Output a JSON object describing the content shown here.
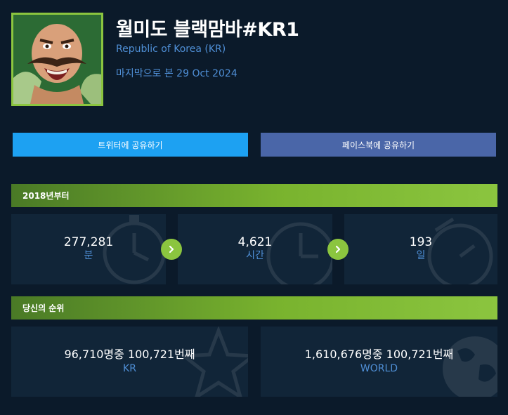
{
  "profile": {
    "summoner_name": "월미도 블랙맘바#KR1",
    "region": "Republic of Korea (KR)",
    "last_seen": "마지막으로 본 29 Oct 2024",
    "avatar_icon": "champion-portrait-icon"
  },
  "share": {
    "twitter_label": "트위터에 공유하기",
    "facebook_label": "페이스북에 공유하기"
  },
  "colors": {
    "accent_green": "#8bc53f",
    "twitter_blue": "#1da1f2",
    "facebook_blue": "#4a66a8",
    "label_blue": "#4f8fd6",
    "background": "#0b1a2a",
    "card": "#112538"
  },
  "time_section": {
    "title": "2018년부터",
    "stats": [
      {
        "value": "277,281",
        "unit": "분",
        "icon": "stopwatch-icon"
      },
      {
        "value": "4,621",
        "unit": "시간",
        "icon": "clock-icon"
      },
      {
        "value": "193",
        "unit": "일",
        "icon": "calendar-clock-icon"
      }
    ]
  },
  "rank_section": {
    "title": "당신의 순위",
    "ranks": [
      {
        "value": "96,710명중 100,721번째",
        "label": "KR",
        "icon": "star-icon"
      },
      {
        "value": "1,610,676명중 100,721번째",
        "label": "WORLD",
        "icon": "globe-icon"
      }
    ]
  }
}
